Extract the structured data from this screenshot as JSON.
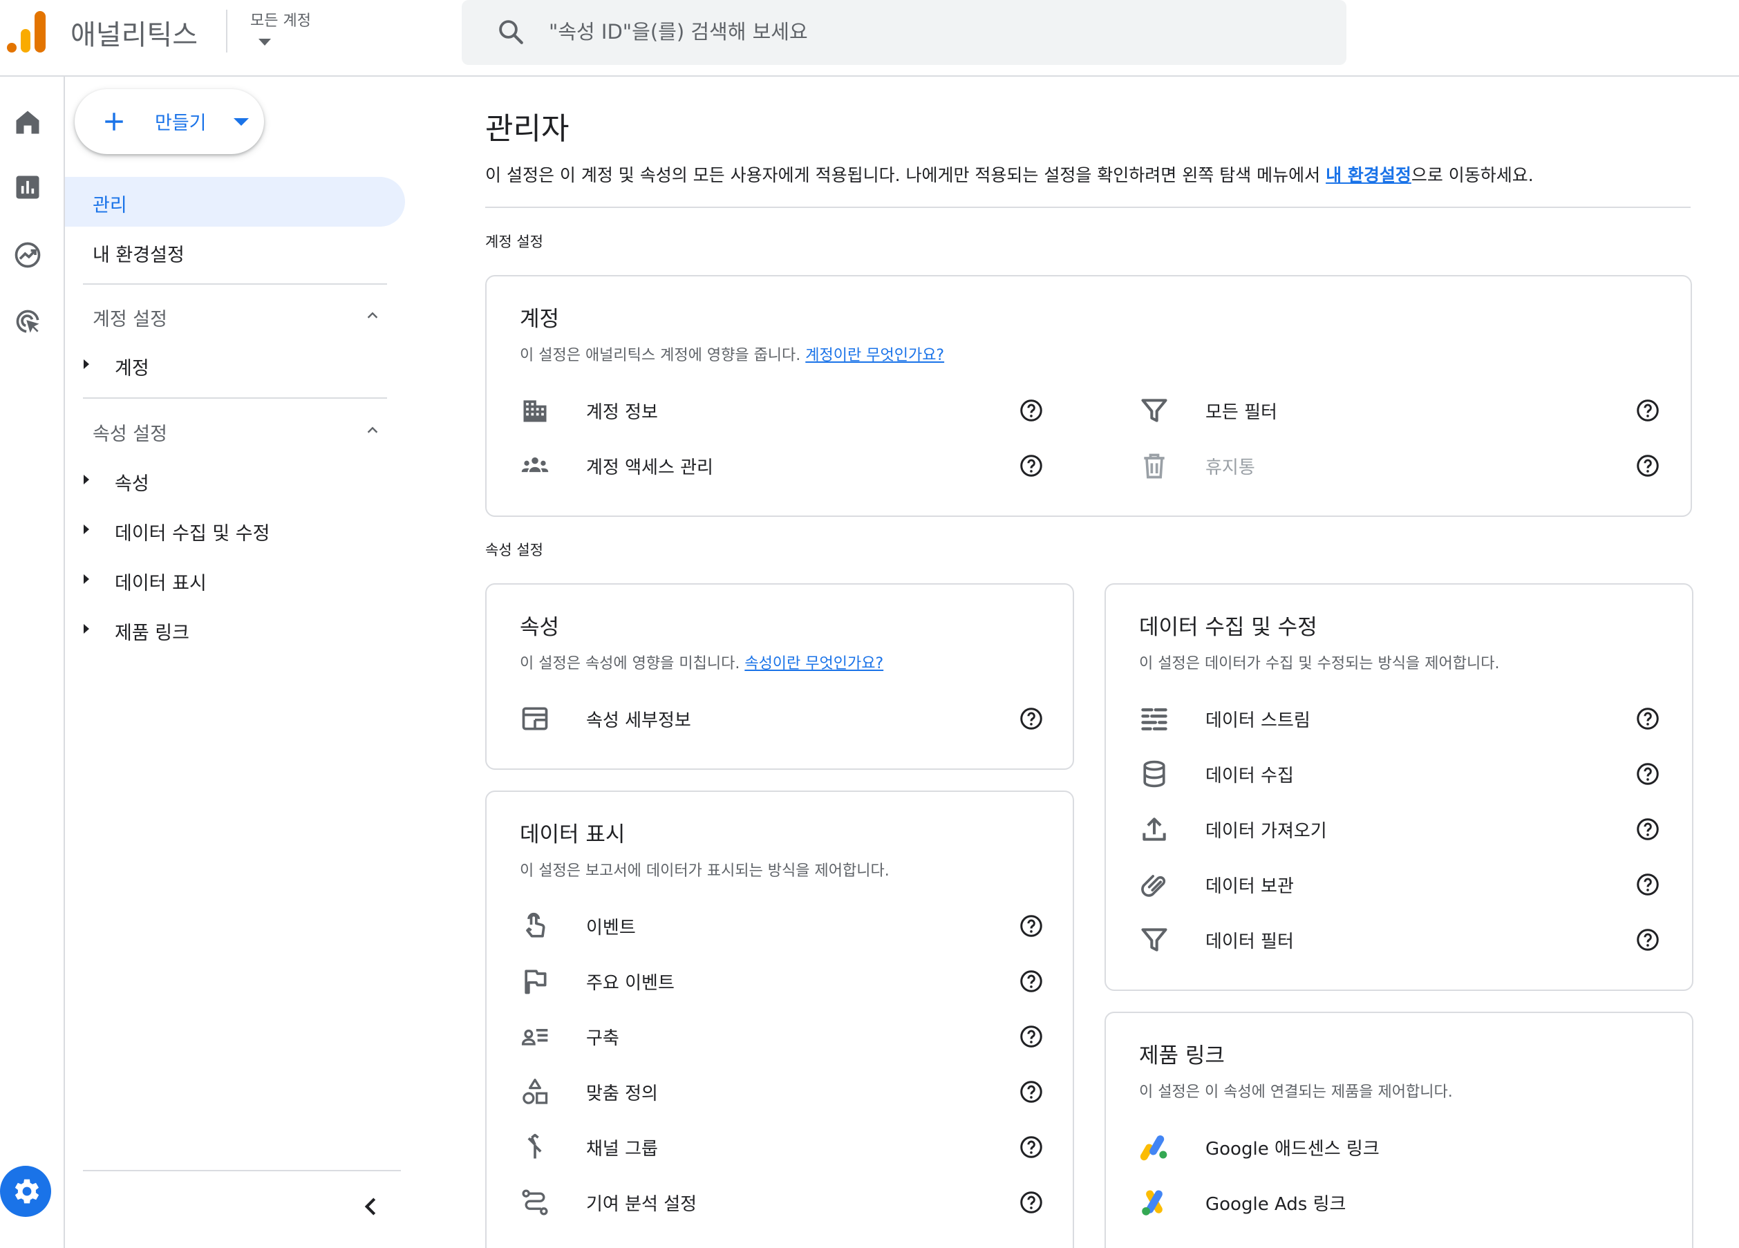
{
  "header": {
    "app_name": "애널리틱스",
    "account_selector": "모든 계정",
    "search_placeholder": "\"속성 ID\"을(를) 검색해 보세요"
  },
  "sidebar": {
    "create_label": "만들기",
    "admin_label": "관리",
    "preferences_label": "내 환경설정",
    "account_section": {
      "title": "계정 설정",
      "items": [
        "계정"
      ]
    },
    "property_section": {
      "title": "속성 설정",
      "items": [
        "속성",
        "데이터 수집 및 수정",
        "데이터 표시",
        "제품 링크"
      ]
    }
  },
  "main": {
    "title": "관리자",
    "description_prefix": "이 설정은 이 계정 및 속성의 모든 사용자에게 적용됩니다. 나에게만 적용되는 설정을 확인하려면 왼쪽 탐색 메뉴에서 ",
    "description_link": "내 환경설정",
    "description_suffix": "으로 이동하세요.",
    "account_group_label": "계정 설정",
    "property_group_label": "속성 설정",
    "account_card": {
      "title": "계정",
      "desc": "이 설정은 애널리틱스 계정에 영향을 줍니다. ",
      "link": "계정이란 무엇인가요?",
      "rows": [
        "계정 정보",
        "계정 액세스 관리",
        "모든 필터",
        "휴지통"
      ]
    },
    "property_card": {
      "title": "속성",
      "desc": "이 설정은 속성에 영향을 미칩니다. ",
      "link": "속성이란 무엇인가요?",
      "rows": [
        "속성 세부정보"
      ]
    },
    "data_collection_card": {
      "title": "데이터 수집 및 수정",
      "desc": "이 설정은 데이터가 수집 및 수정되는 방식을 제어합니다.",
      "rows": [
        "데이터 스트림",
        "데이터 수집",
        "데이터 가져오기",
        "데이터 보관",
        "데이터 필터"
      ]
    },
    "data_display_card": {
      "title": "데이터 표시",
      "desc": "이 설정은 보고서에 데이터가 표시되는 방식을 제어합니다.",
      "rows": [
        "이벤트",
        "주요 이벤트",
        "구축",
        "맞춤 정의",
        "채널 그룹",
        "기여 분석 설정"
      ]
    },
    "product_links_card": {
      "title": "제품 링크",
      "desc": "이 설정은 이 속성에 연결되는 제품을 제어합니다.",
      "rows": [
        "Google 애드센스 링크",
        "Google Ads 링크"
      ]
    }
  },
  "colors": {
    "accent": "#1a73e8",
    "active_bg": "#e8f0fe",
    "logo_orange": "#e37400",
    "logo_yellow": "#f9ab00"
  }
}
